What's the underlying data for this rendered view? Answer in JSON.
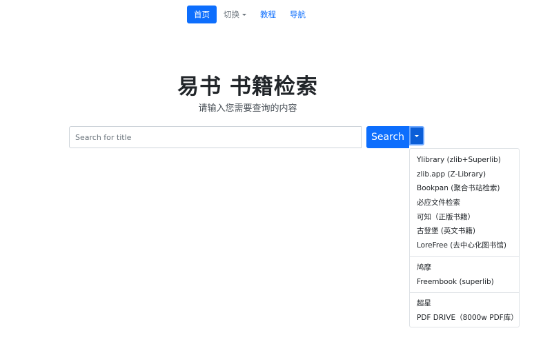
{
  "nav": {
    "items": [
      {
        "label": "首页",
        "active": true
      },
      {
        "label": "切换",
        "dropdown": true
      },
      {
        "label": "教程"
      },
      {
        "label": "导航"
      }
    ]
  },
  "hero": {
    "title": "易书 书籍检索",
    "subtitle": "请输入您需要查询的内容"
  },
  "search": {
    "placeholder": "Search for title",
    "value": "",
    "button_label": "Search"
  },
  "menu": {
    "group1": [
      "Ylibrary (zlib+Superlib)",
      "zlib.app (Z-Library)",
      "Bookpan (聚合书站检索)",
      "必应文件检索",
      "可知（正版书籍）",
      "古登堡 (英文书籍)",
      "LoreFree (去中心化图书馆)"
    ],
    "group2": [
      "鸠摩",
      "Freembook (superlib)"
    ],
    "group3": [
      "超星",
      "PDF DRIVE（8000w PDF库）"
    ]
  },
  "colors": {
    "primary": "#0d6efd",
    "muted": "#6c757d",
    "border": "#dee2e6"
  }
}
